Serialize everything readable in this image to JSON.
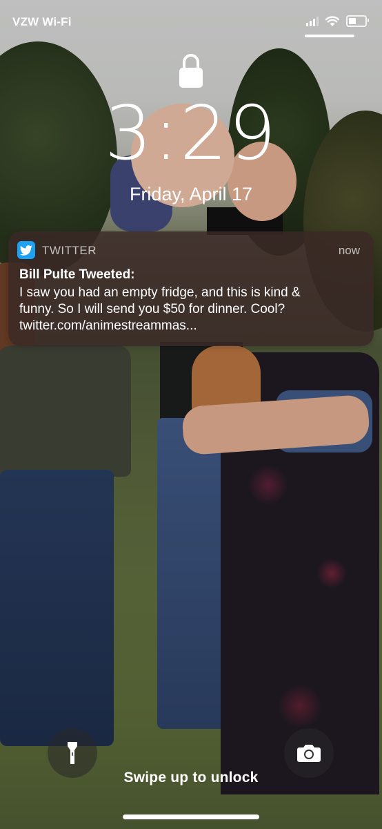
{
  "status_bar": {
    "carrier": "VZW Wi-Fi",
    "signal_bars": 3,
    "battery_level": 0.45
  },
  "lock_screen": {
    "lock_icon": "lock-icon",
    "time": "3:29",
    "date": "Friday, April 17"
  },
  "notification": {
    "app_icon": "twitter-bird-icon",
    "app_name": "TWITTER",
    "timestamp": "now",
    "title": "Bill Pulte Tweeted:",
    "body_lines": [
      "I saw you had an empty fridge, and this is kind &",
      "funny. So I will send you $50 for dinner. Cool?",
      "twitter.com/animestreammas..."
    ],
    "accent_color": "#1da1f2"
  },
  "bottom": {
    "flashlight_icon": "flashlight-icon",
    "camera_icon": "camera-icon",
    "swipe_text": "Swipe up to unlock"
  }
}
